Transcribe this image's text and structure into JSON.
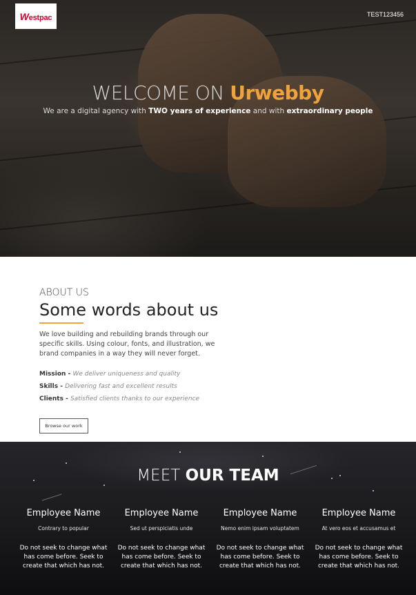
{
  "header": {
    "user_id": "TEST123456"
  },
  "logo": {
    "lead": "W",
    "rest": "estpac"
  },
  "hero": {
    "title_prefix": "WELCOME ON ",
    "title_brand": "Urwebby",
    "subtitle_a": "We are a digital agency with ",
    "subtitle_b": "TWO years of experience",
    "subtitle_c": " and with ",
    "subtitle_d": "extraordinary people"
  },
  "about": {
    "eyebrow": "ABOUT US",
    "heading": "Some words about us",
    "description": "We love building and rebuilding brands through our specific skills. Using colour, fonts, and illustration, we brand companies in a way they will never forget.",
    "items": [
      {
        "label": "Mission - ",
        "text": "We deliver uniqueness and quality"
      },
      {
        "label": "Skills - ",
        "text": "Delivering fast and excellent results"
      },
      {
        "label": "Clients - ",
        "text": "Satisfied clients thanks to our experience"
      }
    ],
    "button_label": "Browse our work"
  },
  "team": {
    "heading_light": "MEET ",
    "heading_bold": "OUR TEAM",
    "members": [
      {
        "name": "Employee Name",
        "role": "Contrary to popular",
        "bio": "Do not seek to change what has come before. Seek to create that which has not."
      },
      {
        "name": "Employee Name",
        "role": "Sed ut perspiciatis unde",
        "bio": "Do not seek to change what has come before. Seek to create that which has not."
      },
      {
        "name": "Employee Name",
        "role": "Nemo enim ipsam voluptatem",
        "bio": "Do not seek to change what has come before. Seek to create that which has not."
      },
      {
        "name": "Employee Name",
        "role": "At vero eos et accusamus et",
        "bio": "Do not seek to change what has come before. Seek to create that which has not."
      }
    ]
  },
  "colors": {
    "accent": "#f0a23b",
    "brand_red": "#d5002b"
  }
}
